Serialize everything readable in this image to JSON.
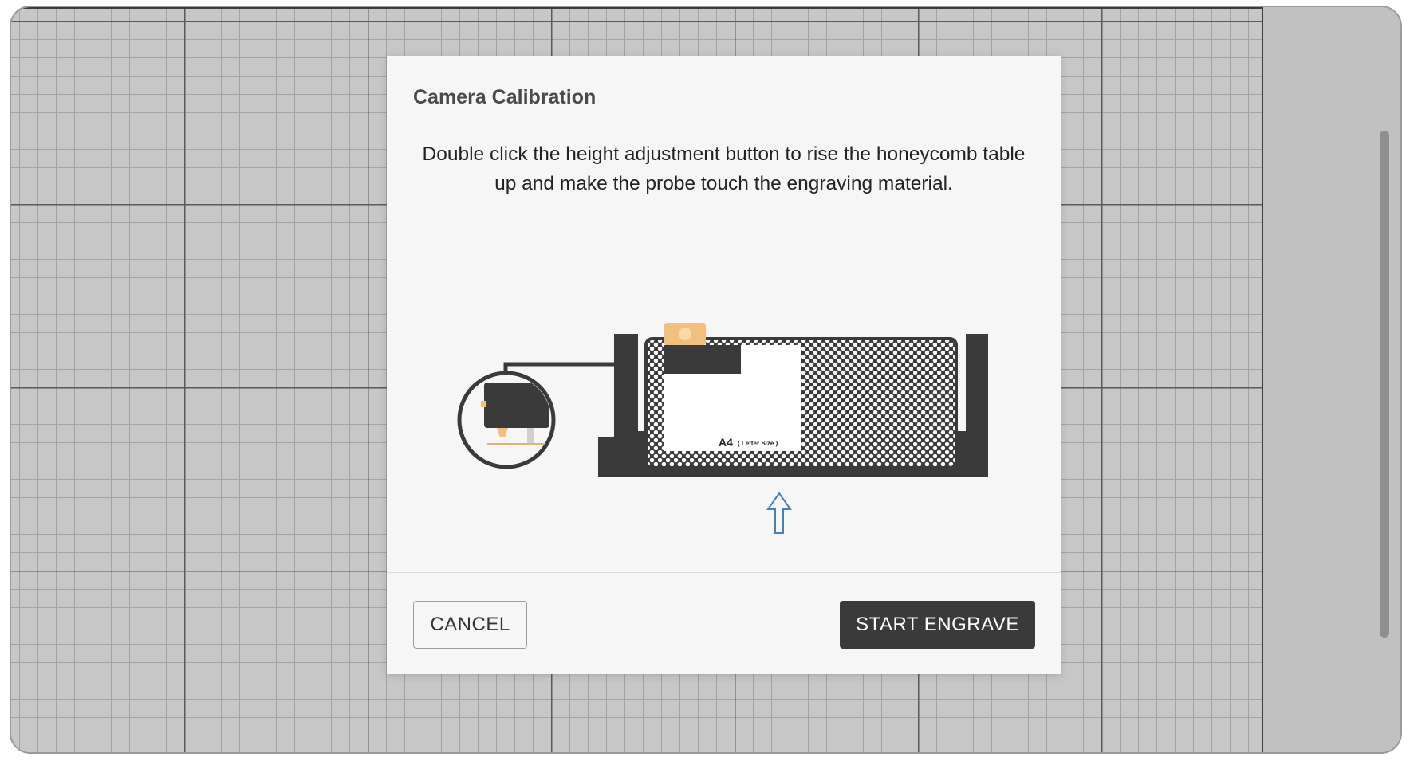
{
  "dialog": {
    "title": "Camera Calibration",
    "message": "Double click the height adjustment button to rise the honeycomb table up and make the probe touch the engraving material.",
    "illustration": {
      "paper_label": "A4",
      "paper_sublabel": "( Letter Size )",
      "arrow_icon": "up-arrow-icon"
    },
    "cancel_label": "CANCEL",
    "start_label": "START ENGRAVE"
  },
  "colors": {
    "accent_dark": "#3a3a3a",
    "probe_orange": "#f2c07e",
    "arrow_blue": "#4a7fb5"
  }
}
